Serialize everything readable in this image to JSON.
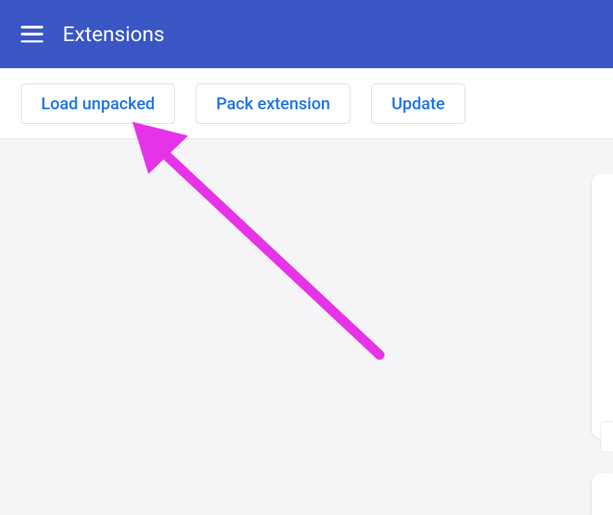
{
  "header": {
    "title": "Extensions"
  },
  "toolbar": {
    "load_unpacked_label": "Load unpacked",
    "pack_extension_label": "Pack extension",
    "update_label": "Update"
  },
  "annotation": {
    "arrow_color": "#e733e7"
  }
}
